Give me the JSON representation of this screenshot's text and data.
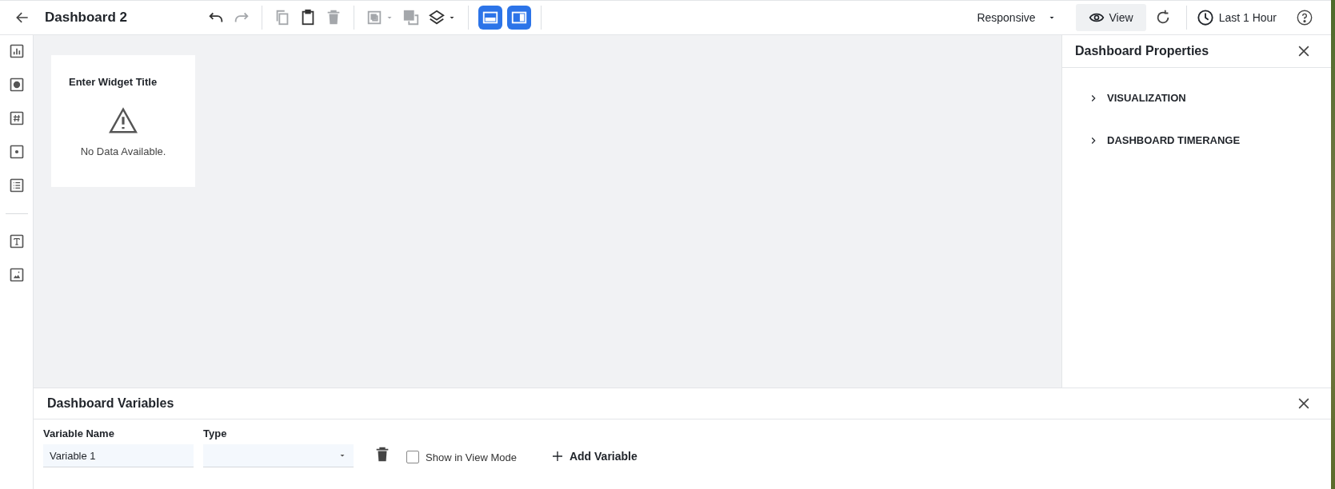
{
  "header": {
    "title": "Dashboard 2"
  },
  "toolbar": [
    [
      {
        "kind": "undo",
        "disabled": false
      },
      {
        "kind": "redo",
        "disabled": true
      }
    ],
    [
      {
        "kind": "copy",
        "disabled": true
      },
      {
        "kind": "paste",
        "disabled": false
      },
      {
        "kind": "delete",
        "disabled": true
      }
    ],
    [
      {
        "kind": "group",
        "disabled": true,
        "menu": true
      },
      {
        "kind": "ungroup",
        "disabled": true,
        "menu": false
      },
      {
        "kind": "layers",
        "disabled": false,
        "menu": true
      }
    ],
    [
      {
        "kind": "layout-bottom",
        "selected": true
      },
      {
        "kind": "layout-right",
        "selected": true
      }
    ]
  ],
  "layout_select": {
    "value": "Responsive"
  },
  "view_button": {
    "label": "View"
  },
  "time_range": {
    "label": "Last 1 Hour"
  },
  "sidebar": {
    "groups": [
      [
        {
          "kind": "bar"
        },
        {
          "kind": "pie"
        },
        {
          "kind": "number"
        },
        {
          "kind": "dot"
        },
        {
          "kind": "list"
        }
      ],
      [
        {
          "kind": "text"
        },
        {
          "kind": "image"
        }
      ]
    ]
  },
  "widget": {
    "title": "Enter Widget Title",
    "message": "No Data Available."
  },
  "properties_panel": {
    "title": "Dashboard Properties",
    "sections": [
      {
        "label": "VISUALIZATION",
        "expanded": false
      },
      {
        "label": "DASHBOARD TIMERANGE",
        "expanded": false
      }
    ]
  },
  "variables_panel": {
    "title": "Dashboard Variables",
    "name_label": "Variable Name",
    "type_label": "Type",
    "name_value": "Variable 1",
    "show_in_view_mode": {
      "label": "Show in View Mode",
      "checked": false
    },
    "add_button": "Add Variable"
  }
}
